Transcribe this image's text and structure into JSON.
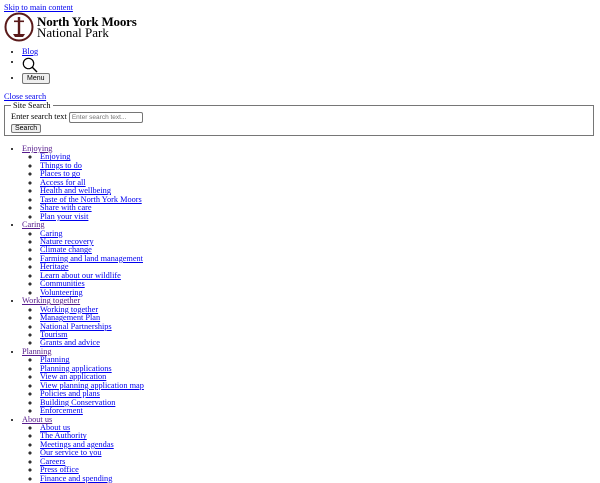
{
  "skip_link": "Skip to main content",
  "logo": {
    "line1": "North York Moors",
    "line2": "National Park"
  },
  "top_links": {
    "blog": "Blog",
    "menu": "Menu"
  },
  "close_search": "Close search",
  "search": {
    "legend": "Site Search",
    "label": "Enter search text",
    "placeholder": "Enter search text...",
    "button": "Search"
  },
  "nav": [
    {
      "label": "Enjoying",
      "children": [
        "Enjoying",
        "Things to do",
        "Places to go",
        "Access for all",
        "Health and wellbeing",
        "Taste of the North York Moors",
        "Share with care",
        "Plan your visit"
      ]
    },
    {
      "label": "Caring",
      "children": [
        "Caring",
        "Nature recovery",
        "Climate change",
        "Farming and land management",
        "Heritage",
        "Learn about our wildlife",
        "Communities",
        "Volunteering"
      ]
    },
    {
      "label": "Working together",
      "children": [
        "Working together",
        "Management Plan",
        "National Partnerships",
        "Tourism",
        "Grants and advice"
      ]
    },
    {
      "label": "Planning",
      "children": [
        "Planning",
        "Planning applications",
        "View an application",
        "View planning application map",
        "Policies and plans",
        "Building Conservation",
        "Enforcement"
      ]
    },
    {
      "label": "About us",
      "children": [
        "About us",
        "The Authority",
        "Meetings and agendas",
        "Our service to you",
        "Careers",
        "Press office",
        "Finance and spending"
      ]
    }
  ],
  "colors": {
    "link": "#0000ee",
    "visited": "#551a8b",
    "logo": "#5a1a1a"
  }
}
